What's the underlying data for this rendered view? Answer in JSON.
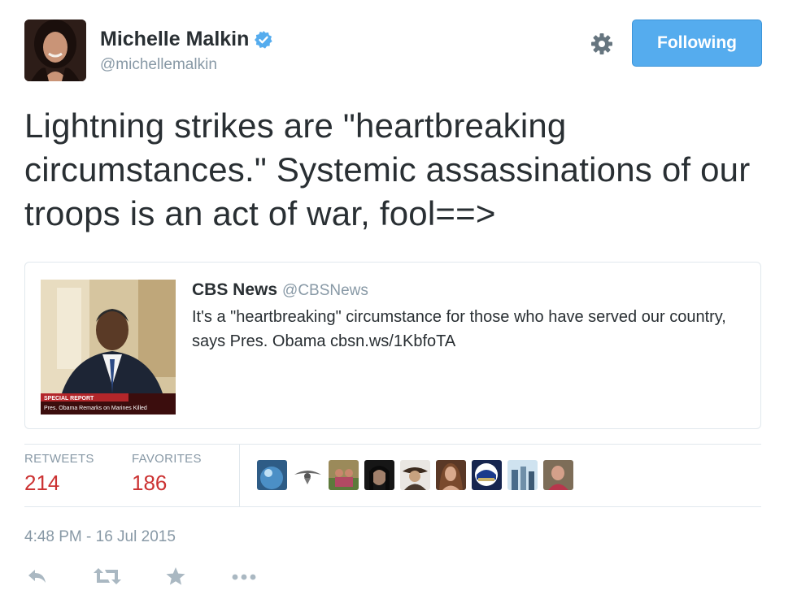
{
  "author": {
    "display_name": "Michelle Malkin",
    "handle": "@michellemalkin",
    "verified": true,
    "avatar_icon": "user-avatar"
  },
  "follow_button": {
    "label": "Following",
    "color": "#55acee"
  },
  "settings_icon": "gear-icon",
  "tweet": {
    "text": "Lightning strikes are \"heartbreaking circumstances.\" Systemic assassinations of our troops is an act of war, fool==>"
  },
  "quoted_tweet": {
    "author_name": "CBS News",
    "author_handle": "@CBSNews",
    "text": "It's a \"heartbreaking\" circumstance for those who have served our country, says Pres. Obama cbsn.ws/1KbfoTA",
    "image_caption_top": "SPECIAL REPORT",
    "image_caption_bottom": "Pres. Obama Remarks on Marines Killed"
  },
  "stats": {
    "retweets_label": "RETWEETS",
    "retweets_count": "214",
    "favorites_label": "FAVORITES",
    "favorites_count": "186"
  },
  "favoriters_count_shown": 9,
  "timestamp": "4:48 PM - 16 Jul 2015",
  "actions": [
    "reply-icon",
    "retweet-icon",
    "favorite-icon",
    "more-icon"
  ]
}
